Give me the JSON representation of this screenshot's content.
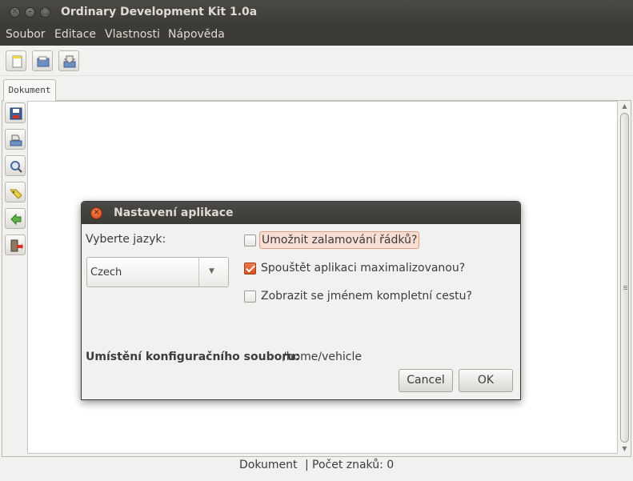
{
  "window": {
    "title": "Ordinary Development Kit 1.0a"
  },
  "menubar": {
    "items": [
      "Soubor",
      "Editace",
      "Vlastnosti",
      "Nápověda"
    ]
  },
  "toolbar": {
    "icons": [
      "new-document-icon",
      "open-document-icon",
      "import-icon"
    ]
  },
  "tabs": [
    {
      "label": "Dokument"
    }
  ],
  "side_toolbar": {
    "icons": [
      "save-icon",
      "edit-icon",
      "zoom-icon",
      "tag-icon",
      "refresh-icon",
      "exit-icon"
    ]
  },
  "statusbar": {
    "document": "Dokument",
    "separator": "|",
    "char_count_label": "Počet znaků: 0"
  },
  "dialog": {
    "title": "Nastavení aplikace",
    "language_label": "Vyberte jazyk:",
    "language_value": "Czech",
    "options": [
      {
        "label": "Umožnit zalamování řádků?",
        "checked": false
      },
      {
        "label": "Spouštět aplikaci maximalizovanou?",
        "checked": true
      },
      {
        "label": "Zobrazit se jménem kompletní cestu?",
        "checked": false
      }
    ],
    "config_label": "Umístění konfiguračního souboru:",
    "config_path": "/home/vehicle",
    "cancel_label": "Cancel",
    "ok_label": "OK"
  },
  "colors": {
    "titlebar": "#3c3b37",
    "accent": "#dd4814"
  }
}
